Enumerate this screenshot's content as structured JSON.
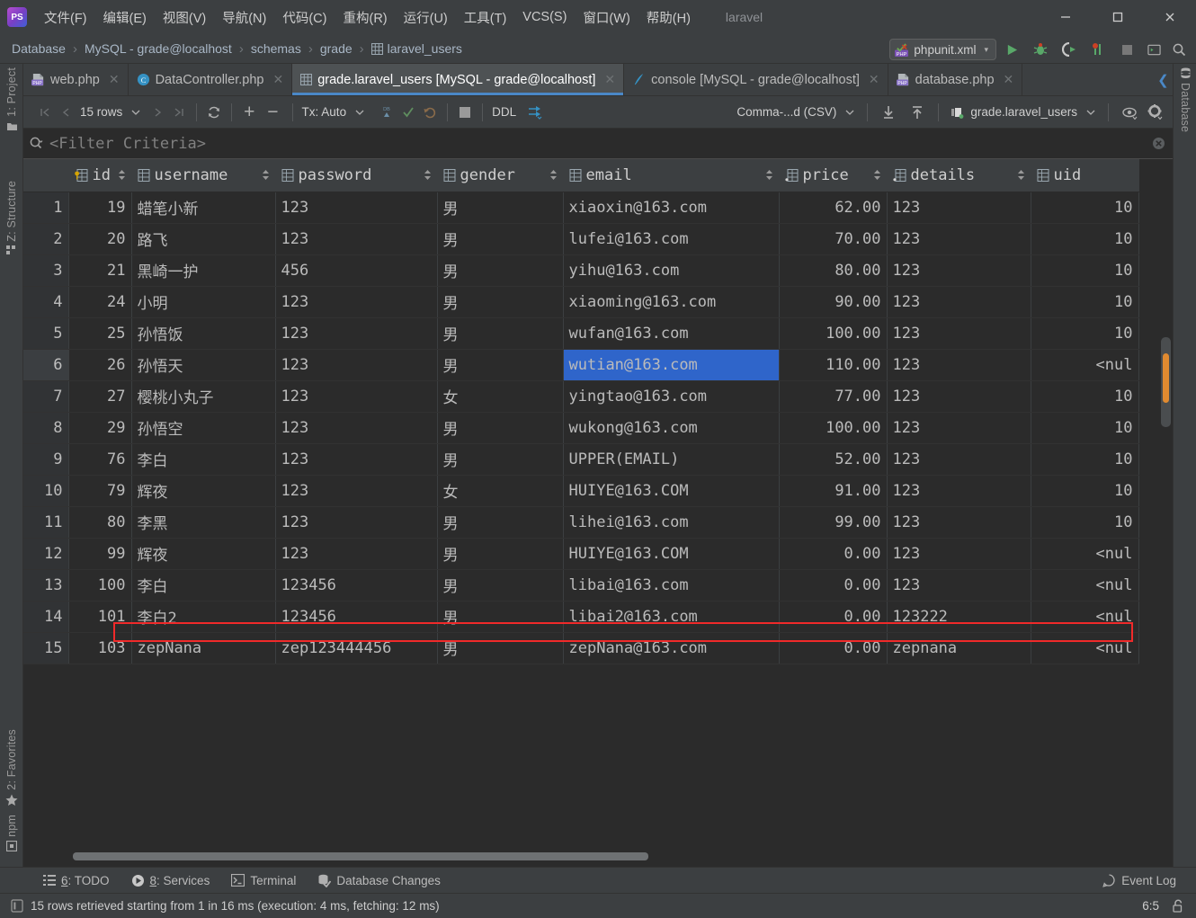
{
  "window": {
    "title": "laravel",
    "controls": {
      "minimize": "—",
      "maximize": "☐",
      "close": "✕"
    }
  },
  "menubar": {
    "items": [
      {
        "label": "文件(F)",
        "name": "menu-file"
      },
      {
        "label": "编辑(E)",
        "name": "menu-edit"
      },
      {
        "label": "视图(V)",
        "name": "menu-view"
      },
      {
        "label": "导航(N)",
        "name": "menu-navigate"
      },
      {
        "label": "代码(C)",
        "name": "menu-code"
      },
      {
        "label": "重构(R)",
        "name": "menu-refactor"
      },
      {
        "label": "运行(U)",
        "name": "menu-run"
      },
      {
        "label": "工具(T)",
        "name": "menu-tools"
      },
      {
        "label": "VCS(S)",
        "name": "menu-vcs"
      },
      {
        "label": "窗口(W)",
        "name": "menu-window"
      },
      {
        "label": "帮助(H)",
        "name": "menu-help"
      }
    ]
  },
  "breadcrumb": {
    "items": [
      {
        "label": "Database",
        "icon": null
      },
      {
        "label": "MySQL - grade@localhost",
        "icon": null
      },
      {
        "label": "schemas",
        "icon": null
      },
      {
        "label": "grade",
        "icon": null
      },
      {
        "label": "laravel_users",
        "icon": "table-icon"
      }
    ],
    "separator": "›"
  },
  "run_config": {
    "label": "phpunit.xml",
    "icon": "phpunit-icon",
    "caret": "▾"
  },
  "nav_buttons": [
    {
      "name": "run-button",
      "title": "Run"
    },
    {
      "name": "debug-button",
      "title": "Debug"
    },
    {
      "name": "run-coverage-button",
      "title": "Run with Coverage"
    },
    {
      "name": "profile-button",
      "title": "Profile"
    },
    {
      "name": "stop-button",
      "title": "Stop"
    },
    {
      "name": "open-terminal-button",
      "title": "Terminal"
    },
    {
      "name": "search-everywhere-button",
      "title": "Search"
    }
  ],
  "tabs": [
    {
      "label": "web.php",
      "icon": "php-file-icon",
      "active": false
    },
    {
      "label": "DataController.php",
      "icon": "php-class-icon",
      "active": false
    },
    {
      "label": "grade.laravel_users [MySQL - grade@localhost]",
      "icon": "table-icon",
      "active": true
    },
    {
      "label": "console [MySQL - grade@localhost]",
      "icon": "console-icon",
      "active": false
    },
    {
      "label": "database.php",
      "icon": "php-file-icon",
      "active": false
    }
  ],
  "tab_close_glyph": "✕",
  "tabbar_right": {
    "prev_tab": "❮",
    "tab_list": "∨"
  },
  "left_strip": [
    {
      "label": "1: Project",
      "name": "sidebar-item-project"
    },
    {
      "label": "Z: Structure",
      "name": "sidebar-item-structure"
    },
    {
      "label": "2: Favorites",
      "name": "sidebar-item-favorites"
    },
    {
      "label": "npm",
      "name": "sidebar-item-npm"
    }
  ],
  "right_strip": [
    {
      "label": "Database",
      "name": "sidebar-item-database"
    }
  ],
  "db_toolbar": {
    "first_page": "|❮",
    "prev_page": "❮",
    "rows_label": "15 rows",
    "rows_caret": "∨",
    "next_page": "❯",
    "last_page": "❯|",
    "reload": "↻",
    "add_row": "+",
    "delete_row": "−",
    "tx_label": "Tx: Auto",
    "tx_caret": "∨",
    "submit_db": "DB",
    "commit": "✓",
    "rollback": "↶",
    "cancel": "■",
    "ddl_label": "DDL",
    "modify_label": "modify-icon",
    "export_format": "Comma-...d (CSV)",
    "export_caret": "∨",
    "download_label": "export-data-icon",
    "upload_label": "import-data-icon",
    "datasource_label": "grade.laravel_users",
    "datasource_caret": "∨",
    "view_label": "view-options-icon",
    "settings_label": "settings-icon"
  },
  "filter": {
    "placeholder": "<Filter Criteria>",
    "icon": "search-filter-icon",
    "clear_icon": "clear-icon"
  },
  "grid": {
    "columns": [
      {
        "key": "rowno",
        "label": "",
        "icon": null,
        "align": "right"
      },
      {
        "key": "id",
        "label": "id",
        "icon": "key-column-icon",
        "align": "right",
        "sortable": true
      },
      {
        "key": "username",
        "label": "username",
        "icon": "text-column-icon",
        "align": "left",
        "sortable": true
      },
      {
        "key": "password",
        "label": "password",
        "icon": "text-column-icon",
        "align": "left",
        "sortable": true
      },
      {
        "key": "gender",
        "label": "gender",
        "icon": "text-column-icon",
        "align": "left",
        "sortable": true
      },
      {
        "key": "email",
        "label": "email",
        "icon": "text-column-icon",
        "align": "left",
        "sortable": true
      },
      {
        "key": "price",
        "label": "price",
        "icon": "num-column-icon",
        "align": "right",
        "sortable": true
      },
      {
        "key": "details",
        "label": "details",
        "icon": "num-column-icon",
        "align": "left",
        "sortable": true
      },
      {
        "key": "uid",
        "label": "uid",
        "icon": "text-column-icon",
        "align": "right",
        "sortable": false
      }
    ],
    "null_text": "<nul",
    "rows": [
      {
        "rowno": "1",
        "id": "19",
        "username": "蜡笔小新",
        "password": "123",
        "gender": "男",
        "email": "xiaoxin@163.com",
        "price": "62.00",
        "details": "123",
        "uid": "10",
        "uid_null": false
      },
      {
        "rowno": "2",
        "id": "20",
        "username": "路飞",
        "password": "123",
        "gender": "男",
        "email": "lufei@163.com",
        "price": "70.00",
        "details": "123",
        "uid": "10",
        "uid_null": false
      },
      {
        "rowno": "3",
        "id": "21",
        "username": "黑崎一护",
        "password": "456",
        "gender": "男",
        "email": "yihu@163.com",
        "price": "80.00",
        "details": "123",
        "uid": "10",
        "uid_null": false
      },
      {
        "rowno": "4",
        "id": "24",
        "username": "小明",
        "password": "123",
        "gender": "男",
        "email": "xiaoming@163.com",
        "price": "90.00",
        "details": "123",
        "uid": "10",
        "uid_null": false
      },
      {
        "rowno": "5",
        "id": "25",
        "username": "孙悟饭",
        "password": "123",
        "gender": "男",
        "email": "wufan@163.com",
        "price": "100.00",
        "details": "123",
        "uid": "10",
        "uid_null": false
      },
      {
        "rowno": "6",
        "id": "26",
        "username": "孙悟天",
        "password": "123",
        "gender": "男",
        "email": "wutian@163.com",
        "price": "110.00",
        "details": "123",
        "uid": "<nul",
        "uid_null": true,
        "selected": true,
        "selected_cell": "email"
      },
      {
        "rowno": "7",
        "id": "27",
        "username": "樱桃小丸子",
        "password": "123",
        "gender": "女",
        "email": "yingtao@163.com",
        "price": "77.00",
        "details": "123",
        "uid": "10",
        "uid_null": false
      },
      {
        "rowno": "8",
        "id": "29",
        "username": "孙悟空",
        "password": "123",
        "gender": "男",
        "email": "wukong@163.com",
        "price": "100.00",
        "details": "123",
        "uid": "10",
        "uid_null": false
      },
      {
        "rowno": "9",
        "id": "76",
        "username": "李白",
        "password": "123",
        "gender": "男",
        "email": "UPPER(EMAIL)",
        "price": "52.00",
        "details": "123",
        "uid": "10",
        "uid_null": false
      },
      {
        "rowno": "10",
        "id": "79",
        "username": "辉夜",
        "password": "123",
        "gender": "女",
        "email": "HUIYE@163.COM",
        "price": "91.00",
        "details": "123",
        "uid": "10",
        "uid_null": false
      },
      {
        "rowno": "11",
        "id": "80",
        "username": "李黑",
        "password": "123",
        "gender": "男",
        "email": "lihei@163.com",
        "price": "99.00",
        "details": "123",
        "uid": "10",
        "uid_null": false
      },
      {
        "rowno": "12",
        "id": "99",
        "username": "辉夜",
        "password": "123",
        "gender": "男",
        "email": "HUIYE@163.COM",
        "price": "0.00",
        "details": "123",
        "uid": "<nul",
        "uid_null": true
      },
      {
        "rowno": "13",
        "id": "100",
        "username": "李白",
        "password": "123456",
        "gender": "男",
        "email": "libai@163.com",
        "price": "0.00",
        "details": "123",
        "uid": "<nul",
        "uid_null": true
      },
      {
        "rowno": "14",
        "id": "101",
        "username": "李白2",
        "password": "123456",
        "gender": "男",
        "email": "libai2@163.com",
        "price": "0.00",
        "details": "123222",
        "uid": "<nul",
        "uid_null": true
      },
      {
        "rowno": "15",
        "id": "103",
        "username": "zepNana",
        "password": "zep123444456",
        "gender": "男",
        "email": "zepNana@163.com",
        "price": "0.00",
        "details": "zepnana",
        "uid": "<nul",
        "uid_null": true
      }
    ]
  },
  "annotation": {
    "color": "#f02a2a",
    "shape": "rectangle"
  },
  "tool_windows": [
    {
      "label": "6: TODO",
      "mnemonic": "6",
      "rest": ": TODO",
      "icon": "todo-icon"
    },
    {
      "label": "8: Services",
      "mnemonic": "8",
      "rest": ": Services",
      "icon": "services-icon"
    },
    {
      "label": "Terminal",
      "mnemonic": "",
      "rest": "Terminal",
      "icon": "terminal-icon"
    },
    {
      "label": "Database Changes",
      "mnemonic": "",
      "rest": "Database Changes",
      "icon": "db-changes-icon"
    }
  ],
  "statusbar": {
    "message": "15 rows retrieved starting from 1 in 16 ms (execution: 4 ms, fetching: 12 ms)",
    "message_icon": "info-icon",
    "event_log": "Event Log",
    "event_log_icon": "event-log-icon",
    "caret_position": "6:5",
    "lock_icon": "unlocked-icon"
  },
  "colors": {
    "accent": "#4a88c7",
    "selection": "#2f65ca",
    "annotation": "#f02a2a",
    "scroll_thumb": "#e08a30",
    "background": "#3c3f41",
    "grid_background": "#2b2b2b"
  }
}
